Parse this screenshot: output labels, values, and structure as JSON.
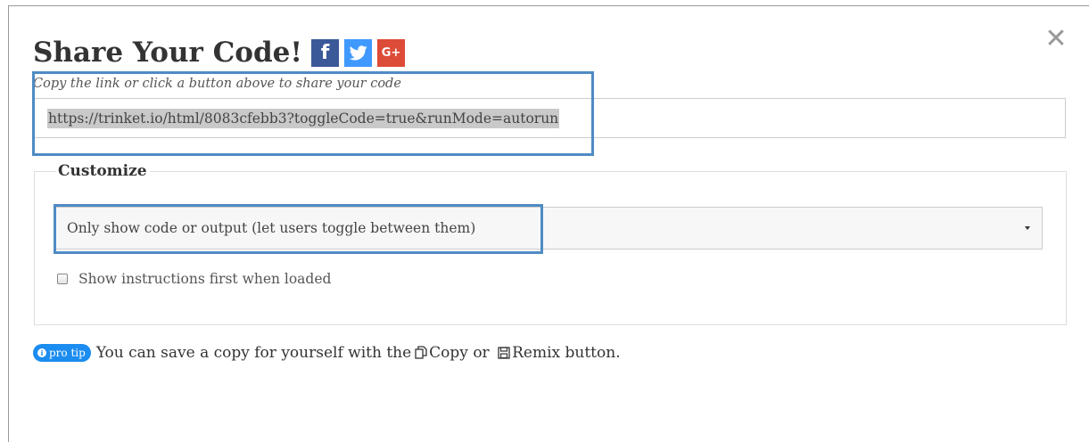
{
  "dialog": {
    "title": "Share Your Code!",
    "close_glyph": "✕",
    "social": {
      "facebook": {
        "glyph": "f",
        "icon": "facebook-icon",
        "color": "#3b5998"
      },
      "twitter": {
        "icon": "twitter-icon",
        "color": "#4099ff"
      },
      "googleplus": {
        "glyph": "G+",
        "icon": "google-plus-icon",
        "color": "#dd4b39"
      }
    }
  },
  "share": {
    "hint": "Copy the link or click a button above to share your code",
    "link": "https://trinket.io/html/8083cfebb3?toggleCode=true&runMode=autorun"
  },
  "customize": {
    "legend": "Customize",
    "select_value": "Only show code or output (let users toggle between them)",
    "checkbox_label": "Show instructions first when loaded",
    "checkbox_checked": false
  },
  "tip": {
    "badge": "pro tip",
    "text_before": "You can save a copy for yourself with the",
    "copy_label": "Copy",
    "or": "or",
    "remix_label": "Remix",
    "text_after": "button."
  },
  "colors": {
    "highlight": "#4f8bc4",
    "pro_tip_badge": "#1b8cf0"
  }
}
